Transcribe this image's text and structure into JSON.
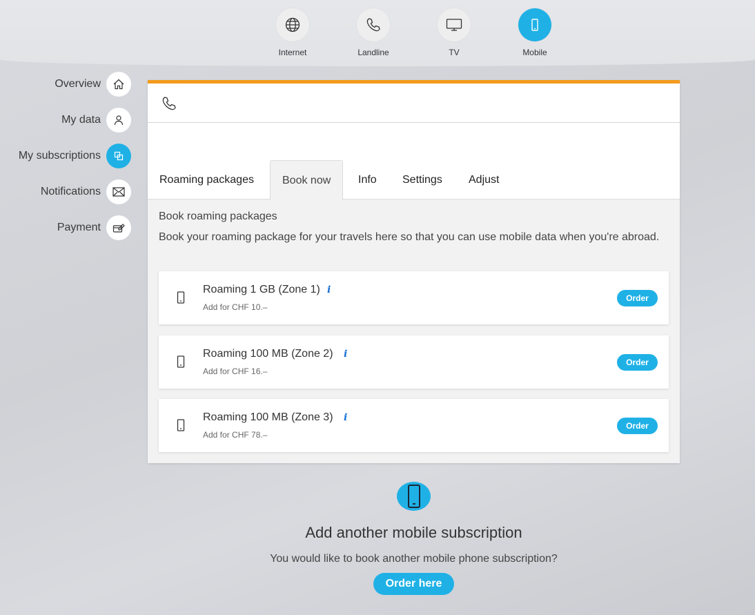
{
  "services": [
    {
      "label": "Internet",
      "icon": "globe-icon"
    },
    {
      "label": "Landline",
      "icon": "phone-icon"
    },
    {
      "label": "TV",
      "icon": "tv-icon"
    },
    {
      "label": "Mobile",
      "icon": "mobile-icon",
      "active": true
    }
  ],
  "nav": [
    {
      "label": "Overview",
      "icon": "home-icon"
    },
    {
      "label": "My data",
      "icon": "user-icon"
    },
    {
      "label": "My subscriptions",
      "icon": "subscriptions-icon",
      "active": true
    },
    {
      "label": "Notifications",
      "icon": "envelope-icon"
    },
    {
      "label": "Payment",
      "icon": "payment-icon"
    }
  ],
  "card": {
    "header_icon": "phone-icon",
    "accent_color": "#f39a1b",
    "tabs": [
      {
        "label": "Roaming packages"
      },
      {
        "label": "Book now",
        "active": true
      },
      {
        "label": "Info"
      },
      {
        "label": "Settings"
      },
      {
        "label": "Adjust"
      }
    ],
    "section_title": "Book roaming packages",
    "section_desc": "Book your roaming package for your travels here so that you can use mobile data when you're abroad.",
    "packages": [
      {
        "name": "Roaming 1 GB (Zone 1)",
        "price": "Add for CHF 10.–",
        "info": "i",
        "order_label": "Order"
      },
      {
        "name": "Roaming 100 MB (Zone 2)",
        "price": "Add for CHF 16.–",
        "info": "i",
        "order_label": "Order"
      },
      {
        "name": "Roaming 100 MB (Zone 3)",
        "price": "Add for CHF 78.–",
        "info": "i",
        "order_label": "Order"
      }
    ]
  },
  "add_section": {
    "icon": "mobile-icon",
    "title": "Add another mobile subscription",
    "desc": "You would like to book another mobile phone subscription?",
    "button": "Order here"
  },
  "colors": {
    "brand": "#1fb1e6",
    "accent": "#f39a1b",
    "info": "#1a6fd6"
  }
}
